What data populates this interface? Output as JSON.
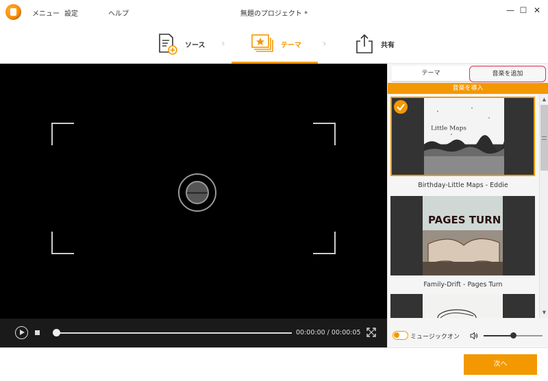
{
  "window": {
    "title": "無題のプロジェクト *"
  },
  "menu": {
    "items": [
      "メニュー",
      "設定",
      "ヘルプ"
    ]
  },
  "steps": [
    {
      "label": "ソース",
      "icon": "source-doc-icon",
      "active": false
    },
    {
      "label": "テーマ",
      "icon": "theme-star-icon",
      "active": true
    },
    {
      "label": "共有",
      "icon": "share-upload-icon",
      "active": false
    }
  ],
  "player": {
    "timecode": "00:00:00 / 00:00:05",
    "progress": 0
  },
  "panel": {
    "tab_theme": "テーマ",
    "tab_add_music": "音楽を追加",
    "import_music": "音楽を導入",
    "themes": [
      {
        "title": "Birthday-Little Maps - Eddie",
        "art_text": "Little Maps",
        "selected": true
      },
      {
        "title": "Family-Drift - Pages Turn",
        "art_text": "PAGES TURN",
        "selected": false
      },
      {
        "title": "",
        "art_text": "",
        "selected": false
      }
    ],
    "music_toggle_label": "ミュージックオン",
    "music_on": true,
    "volume": 0.5
  },
  "footer": {
    "next_label": "次へ"
  },
  "colors": {
    "accent": "#f39800",
    "highlight": "#e0304a"
  }
}
